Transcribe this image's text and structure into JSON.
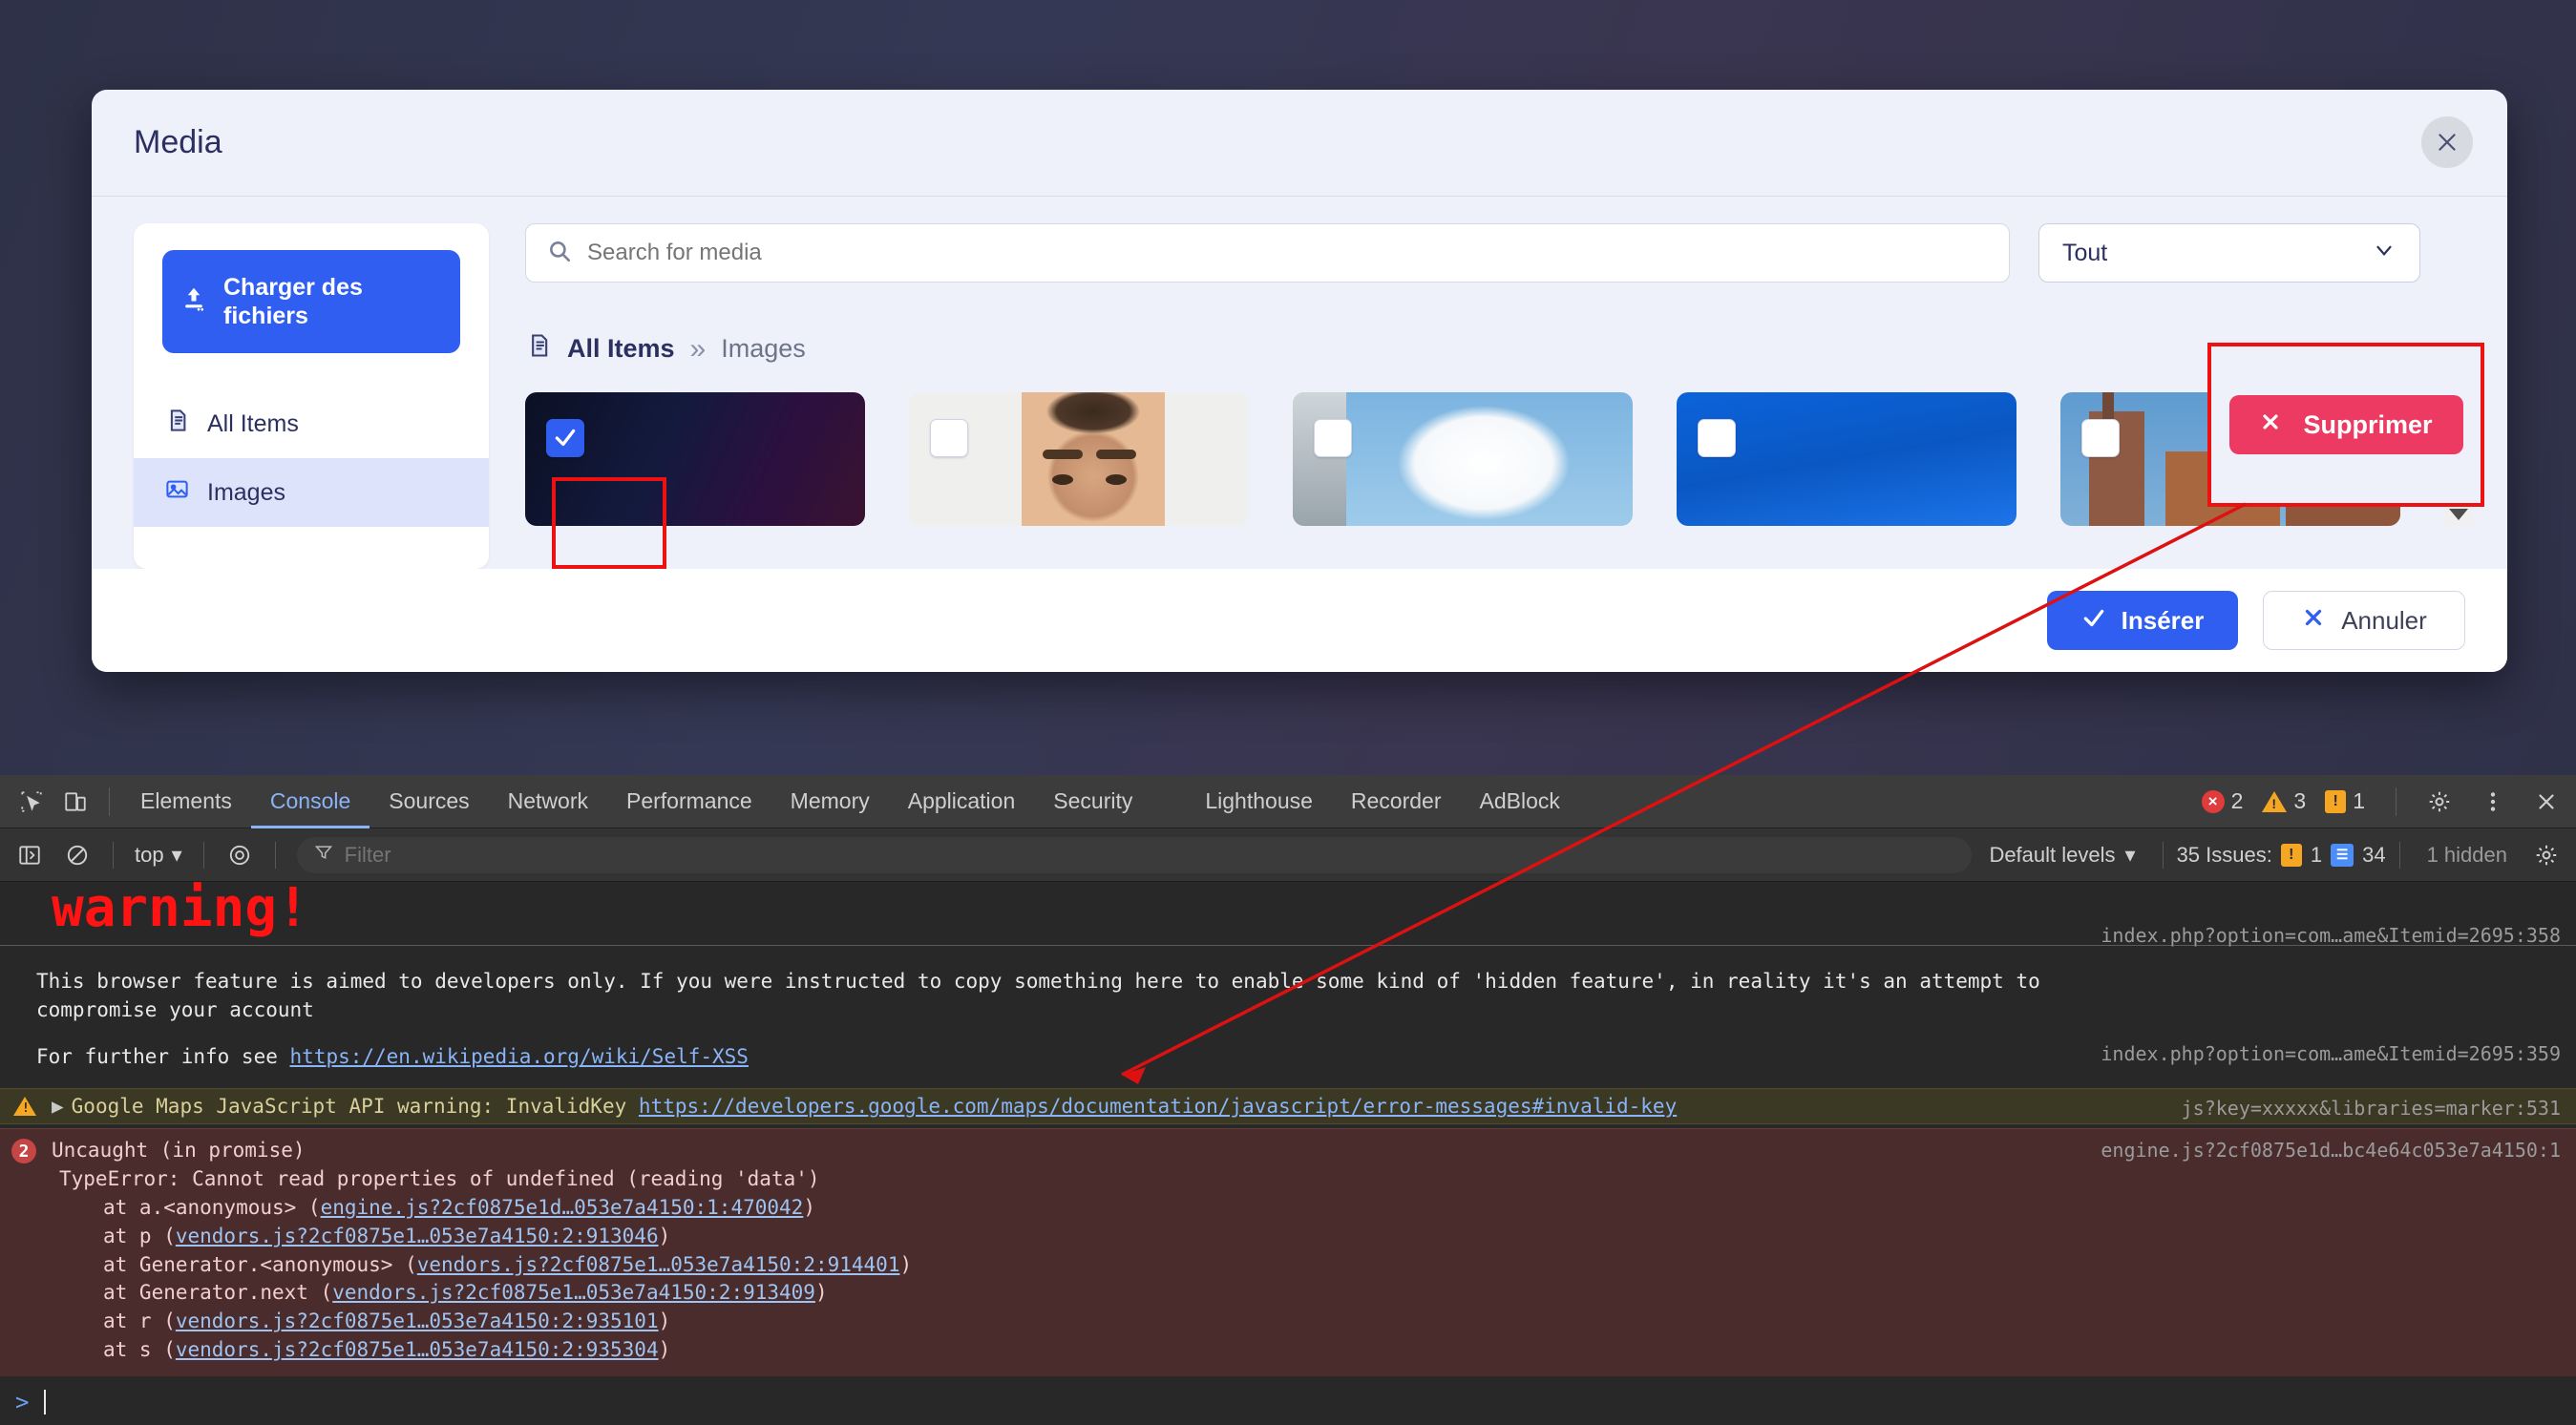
{
  "modal": {
    "title": "Media",
    "close_icon": "close-icon",
    "sidebar": {
      "upload_label": "Charger des fichiers",
      "items": [
        {
          "label": "All Items",
          "icon": "document-icon",
          "active": false
        },
        {
          "label": "Images",
          "icon": "image-icon",
          "active": true
        }
      ]
    },
    "toolbar": {
      "search_placeholder": "Search for media",
      "search_value": "",
      "type_filter_value": "Tout"
    },
    "breadcrumb": {
      "root": "All Items",
      "separator": "»",
      "current": "Images"
    },
    "thumbnails": [
      {
        "name": "dark-gradient-image",
        "selected": true
      },
      {
        "name": "portrait-face-image",
        "selected": false
      },
      {
        "name": "cloud-sky-image",
        "selected": false
      },
      {
        "name": "blue-sky-image",
        "selected": false
      },
      {
        "name": "city-buildings-image",
        "selected": false
      }
    ],
    "delete_button": {
      "label": "Supprimer",
      "color": "#ed3a63"
    },
    "footer": {
      "insert_label": "Insérer",
      "cancel_label": "Annuler"
    }
  },
  "devtools": {
    "tabs": [
      {
        "label": "Elements",
        "active": false
      },
      {
        "label": "Console",
        "active": true
      },
      {
        "label": "Sources",
        "active": false
      },
      {
        "label": "Network",
        "active": false
      },
      {
        "label": "Performance",
        "active": false
      },
      {
        "label": "Memory",
        "active": false
      },
      {
        "label": "Application",
        "active": false
      },
      {
        "label": "Security",
        "active": false
      },
      {
        "label": "Lighthouse",
        "active": false
      },
      {
        "label": "Recorder",
        "active": false
      },
      {
        "label": "AdBlock",
        "active": false
      }
    ],
    "counts": {
      "errors": "2",
      "warnings": "3",
      "infos": "1"
    },
    "filterbar": {
      "context": "top",
      "filter_placeholder": "Filter",
      "filter_value": "",
      "levels_label": "Default levels",
      "issues_label": "35 Issues:",
      "issues_warn": "1",
      "issues_info": "34",
      "hidden_label": "1 hidden"
    },
    "console": {
      "warning_banner": "warning!",
      "msg1": "This browser feature is aimed to developers only. If you were instructed to copy something here to enable some kind of 'hidden feature', in reality it's an attempt to compromise your account",
      "msg1_src": "index.php?option=com…ame&Itemid=2695:358",
      "msg2_prefix": "For further info see ",
      "msg2_link": "https://en.wikipedia.org/wiki/Self-XSS",
      "msg2_src": "index.php?option=com…ame&Itemid=2695:359",
      "maps_warning": "Google Maps JavaScript API warning: InvalidKey",
      "maps_link": "https://developers.google.com/maps/documentation/javascript/error-messages#invalid-key",
      "maps_src": "js?key=xxxxx&libraries=marker:531",
      "error_badge": "2",
      "error_title": "Uncaught (in promise)",
      "error_type": "TypeError: Cannot read properties of undefined (reading 'data')",
      "error_src": "engine.js?2cf0875e1d…bc4e64c053e7a4150:1",
      "stack": [
        {
          "fn": "at a.<anonymous> (",
          "link": "engine.js?2cf0875e1d…053e7a4150:1:470042",
          "close": ")"
        },
        {
          "fn": "at p (",
          "link": "vendors.js?2cf0875e1…053e7a4150:2:913046",
          "close": ")"
        },
        {
          "fn": "at Generator.<anonymous> (",
          "link": "vendors.js?2cf0875e1…053e7a4150:2:914401",
          "close": ")"
        },
        {
          "fn": "at Generator.next (",
          "link": "vendors.js?2cf0875e1…053e7a4150:2:913409",
          "close": ")"
        },
        {
          "fn": "at r (",
          "link": "vendors.js?2cf0875e1…053e7a4150:2:935101",
          "close": ")"
        },
        {
          "fn": "at s (",
          "link": "vendors.js?2cf0875e1…053e7a4150:2:935304",
          "close": ")"
        }
      ],
      "prompt_symbol": ">"
    }
  }
}
